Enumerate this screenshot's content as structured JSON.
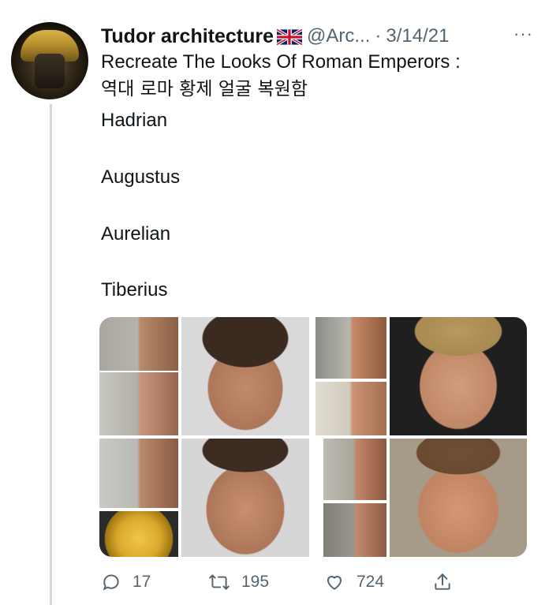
{
  "tweet": {
    "display_name": "Tudor architecture",
    "flag_icon": "uk-flag-icon",
    "handle": "@Arc...",
    "separator": "·",
    "date": "3/14/21",
    "more": "···",
    "lines": [
      "Recreate The Looks Of Roman Emperors :",
      "역대 로마 황제 얼굴 복원함",
      "Hadrian",
      "Augustus",
      "Aurelian",
      "Tiberius"
    ]
  },
  "actions": {
    "reply_count": "17",
    "retweet_count": "195",
    "like_count": "724"
  },
  "colors": {
    "muted": "#536471",
    "text": "#0f1419",
    "thread_line": "#cfd9de"
  }
}
